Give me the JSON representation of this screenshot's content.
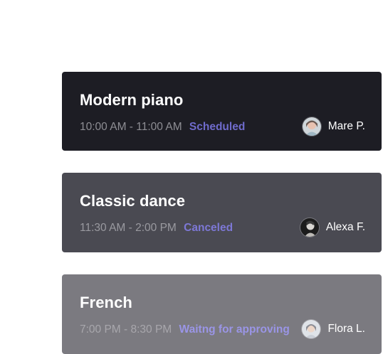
{
  "lessons": [
    {
      "title": "Modern piano",
      "time": "10:00 AM - 11:00 AM",
      "status": "Scheduled",
      "status_color": "#6f6bcc",
      "person": "Mare P.",
      "avatar_icon": "user-photo"
    },
    {
      "title": "Classic dance",
      "time": "11:30 AM - 2:00 PM",
      "status": "Canceled",
      "status_color": "#7d78d6",
      "person": "Alexa F.",
      "avatar_icon": "user-photo"
    },
    {
      "title": "French",
      "time": "7:00 PM - 8:30 PM",
      "status": "Waitng for approving",
      "status_color": "#9a95e6",
      "person": "Flora L.",
      "avatar_icon": "user-photo"
    }
  ],
  "colors": {
    "card_dark": "#1d1d24",
    "card_mid": "#4a4a52",
    "card_light": "#7b7a80"
  }
}
